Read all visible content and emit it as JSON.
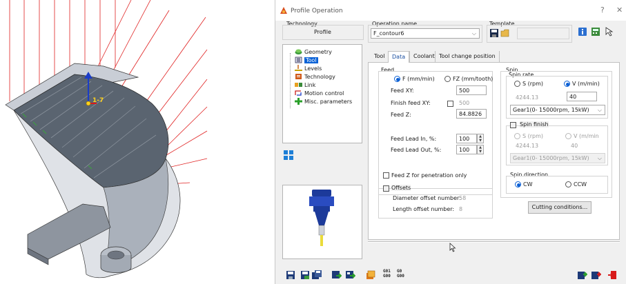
{
  "dialog": {
    "title": "Profile Operation",
    "help_glyph": "?",
    "close_glyph": "✕"
  },
  "technology": {
    "label": "Technology",
    "value": "Profile"
  },
  "operation": {
    "label": "Operation name",
    "value": "F_contour6"
  },
  "template": {
    "label": "Template"
  },
  "tree": {
    "items": [
      {
        "label": "Geometry",
        "icon": "geometry-icon"
      },
      {
        "label": "Tool",
        "icon": "tool-icon",
        "selected": true
      },
      {
        "label": "Levels",
        "icon": "levels-icon"
      },
      {
        "label": "Technology",
        "icon": "technology-icon"
      },
      {
        "label": "Link",
        "icon": "link-icon"
      },
      {
        "label": "Motion control",
        "icon": "motion-control-icon"
      },
      {
        "label": "Misc. parameters",
        "icon": "misc-parameters-icon"
      }
    ]
  },
  "tabs": [
    "Tool",
    "Data",
    "Coolant",
    "Tool change position"
  ],
  "active_tab": "Data",
  "feed": {
    "group_label": "Feed",
    "radio_f": "F (mm/min)",
    "radio_fz": "FZ (mm/tooth)",
    "feed_xy_label": "Feed XY:",
    "feed_xy_value": "500",
    "finish_feed_xy_label": "Finish feed XY:",
    "finish_feed_xy_value": "500",
    "feed_z_label": "Feed Z:",
    "feed_z_value": "84.8826",
    "lead_in_label": "Feed Lead In, %:",
    "lead_in_value": "100",
    "lead_out_label": "Feed Lead Out, %:",
    "lead_out_value": "100",
    "penetration_label": "Feed Z for penetration only",
    "offsets_label": "Offsets",
    "diameter_offset_label": "Diameter offset number:",
    "diameter_offset_value": "58",
    "length_offset_label": "Length offset number:",
    "length_offset_value": "8"
  },
  "spin": {
    "group_label": "Spin",
    "rate_label": "Spin rate",
    "radio_s": "S (rpm)",
    "radio_v": "V (m/min)",
    "s_value": "4244.13",
    "v_value": "40",
    "gear_value": "Gear1(0- 15000rpm, 15kW)",
    "finish_label": "Spin finish",
    "finish_radio_s": "S (rpm)",
    "finish_radio_v": "V (m/min",
    "finish_s_value": "4244.13",
    "finish_v_value": "40",
    "finish_gear_value": "Gear1(0- 15000rpm, 15kW)",
    "direction_label": "Spin direction",
    "radio_cw": "CW",
    "radio_ccw": "CCW",
    "cutting_conditions_label": "Cutting conditions..."
  },
  "viewport": {
    "triad_label": "1-7"
  },
  "bottom_toolbar": {
    "gcode_label_1a": "G01",
    "gcode_label_1b": "G00",
    "gcode_label_2a": "G0",
    "gcode_label_2b": "G00"
  },
  "colors": {
    "accent": "#0a62d6",
    "part_dark": "#5a6470",
    "part_light": "#c2c8d0",
    "toolpath_red": "#e02020",
    "tool_blue": "#1c3a9a"
  }
}
